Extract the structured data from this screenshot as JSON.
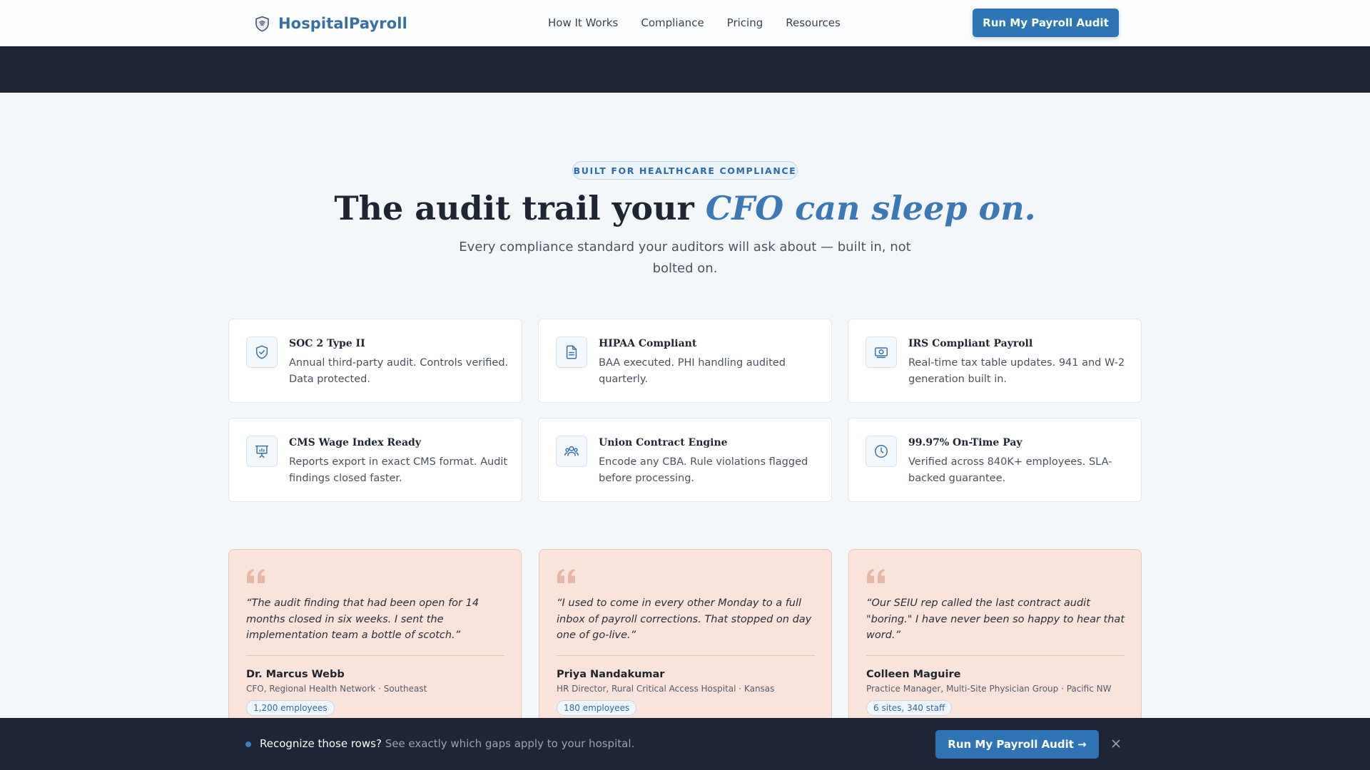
{
  "header": {
    "brand": "HospitalPayroll",
    "nav": [
      "How It Works",
      "Compliance",
      "Pricing",
      "Resources"
    ],
    "cta": "Run My Payroll Audit",
    "icons": {
      "brand": "shield-logo-icon"
    }
  },
  "hero": {
    "badge": "BUILT FOR HEALTHCARE COMPLIANCE",
    "title_plain": "The audit trail your ",
    "title_accent": "CFO can sleep on.",
    "subtitle": "Every compliance standard your auditors will ask about — built in, not bolted on."
  },
  "features": [
    {
      "icon": "shield-check-icon",
      "title": "SOC 2 Type II",
      "desc": "Annual third-party audit. Controls verified. Data protected."
    },
    {
      "icon": "document-icon",
      "title": "HIPAA Compliant",
      "desc": "BAA executed. PHI handling audited quarterly."
    },
    {
      "icon": "banknote-icon",
      "title": "IRS Compliant Payroll",
      "desc": "Real-time tax table updates. 941 and W-2 generation built in."
    },
    {
      "icon": "presentation-chart-icon",
      "title": "CMS Wage Index Ready",
      "desc": "Reports export in exact CMS format. Audit findings closed faster."
    },
    {
      "icon": "users-icon",
      "title": "Union Contract Engine",
      "desc": "Encode any CBA. Rule violations flagged before processing."
    },
    {
      "icon": "clock-icon",
      "title": "99.97% On-Time Pay",
      "desc": "Verified across 840K+ employees. SLA-backed guarantee."
    }
  ],
  "testimonials": [
    {
      "quote": "“The audit finding that had been open for 14 months closed in six weeks. I sent the implementation team a bottle of scotch.”",
      "name": "Dr. Marcus Webb",
      "role": "CFO, Regional Health Network · Southeast",
      "tag": "1,200 employees"
    },
    {
      "quote": "“I used to come in every other Monday to a full inbox of payroll corrections. That stopped on day one of go-live.”",
      "name": "Priya Nandakumar",
      "role": "HR Director, Rural Critical Access Hospital · Kansas",
      "tag": "180 employees"
    },
    {
      "quote": "“Our SEIU rep called the last contract audit \"boring.\" I have never been so happy to hear that word.”",
      "name": "Colleen Maguire",
      "role": "Practice Manager, Multi-Site Physician Group · Pacific NW",
      "tag": "6 sites, 340 staff"
    }
  ],
  "sticky": {
    "strong": "Recognize those rows?",
    "muted": "See exactly which gaps apply to your hospital.",
    "cta": "Run My Payroll Audit →",
    "close_icon": "close-icon"
  },
  "colors": {
    "brand": "#3a6fa6",
    "cta": "#2f74b5",
    "dark": "#1d2537",
    "testimonial_bg": "#f9e3db"
  }
}
